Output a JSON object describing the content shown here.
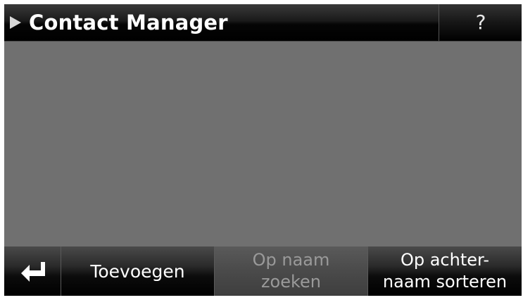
{
  "header": {
    "title": "Contact Manager",
    "help_label": "?"
  },
  "icons": {
    "title_indicator": "play-arrow-icon",
    "back": "return-arrow-icon"
  },
  "toolbar": {
    "add_label": "Toevoegen",
    "search_line1": "Op naam",
    "search_line2": "zoeken",
    "search_enabled": false,
    "sort_line1": "Op achter-",
    "sort_line2": "naam sorteren"
  },
  "colors": {
    "background": "#707070",
    "bar": "#000000",
    "text": "#ffffff",
    "disabled_text": "#9a9a9a"
  }
}
